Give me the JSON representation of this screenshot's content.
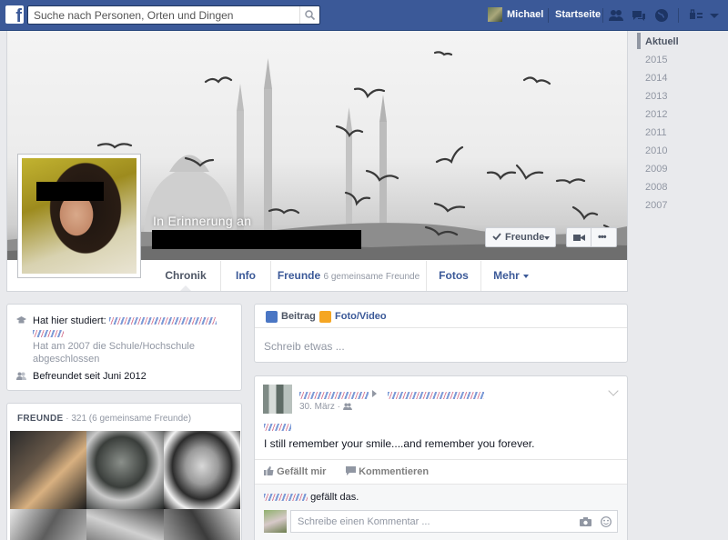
{
  "topbar": {
    "logo": "f",
    "search_placeholder": "Suche nach Personen, Orten und Dingen",
    "user_name": "Michael",
    "home_label": "Startseite"
  },
  "timeline": {
    "years": [
      "Aktuell",
      "2015",
      "2014",
      "2013",
      "2012",
      "2011",
      "2010",
      "2009",
      "2008",
      "2007"
    ]
  },
  "cover": {
    "memorial_text": "In Erinnerung an"
  },
  "buttons": {
    "friends_label": "Freunde",
    "more_label": "•••"
  },
  "tabs": {
    "chronik": "Chronik",
    "info": "Info",
    "freunde": "Freunde",
    "freunde_mutual": "6 gemeinsame Freunde",
    "fotos": "Fotos",
    "mehr": "Mehr"
  },
  "about": {
    "studied_prefix": "Hat hier studiert:",
    "studied_sub": "Hat am 2007 die Schule/Hochschule abgeschlossen",
    "friends_since": "Befreundet seit Juni 2012"
  },
  "friends_box": {
    "title": "FREUNDE",
    "count": "· 321 (6 gemeinsame Freunde)"
  },
  "composer": {
    "post_label": "Beitrag",
    "photo_label": "Foto/Video",
    "placeholder": "Schreib etwas ..."
  },
  "post": {
    "date": "30. März ·",
    "body": "I still remember your smile....and remember you forever.",
    "like_label": "Gefällt mir",
    "comment_label": "Kommentieren",
    "likes_suffix": "gefällt das.",
    "comment_placeholder": "Schreibe einen Kommentar ..."
  },
  "colors": {
    "brand": "#3b5998",
    "background": "#e9eaed",
    "muted": "#9197a3"
  }
}
